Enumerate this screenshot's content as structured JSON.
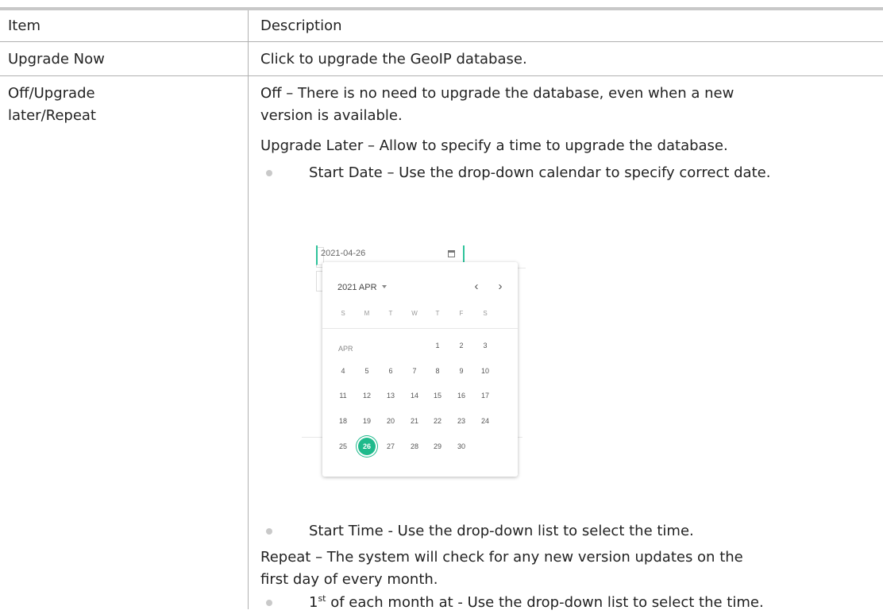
{
  "table": {
    "header": {
      "item": "Item",
      "description": "Description"
    },
    "row_upgrade_now": {
      "item": "Upgrade Now",
      "description": "Click to upgrade the GeoIP database."
    },
    "row_off": {
      "item": "Off/Upgrade later/Repeat",
      "off_line1": "Off – There is no need to upgrade the database, even when a new",
      "off_line2": "version is available.",
      "upgrade_later": "Upgrade Later – Allow to specify a time to upgrade the database.",
      "start_date": "Start Date – Use the drop-down calendar to specify correct date.",
      "start_time": "Start Time - Use the drop-down list to select the time.",
      "repeat_line1": "Repeat – The system will check for any new version updates on the",
      "repeat_line2": "first day of every month.",
      "first_prefix": "1",
      "first_sup": "st",
      "first_rest": " of each month at - Use the drop-down list to select the time."
    }
  },
  "calendar": {
    "input_value": "2021-04-26",
    "header": "2021 APR",
    "prev": "‹",
    "next": "›",
    "weekdays": [
      "S",
      "M",
      "T",
      "W",
      "T",
      "F",
      "S"
    ],
    "month_label": "APR",
    "weeks": [
      [
        "",
        "",
        "",
        "",
        "1",
        "2",
        "3"
      ],
      [
        "4",
        "5",
        "6",
        "7",
        "8",
        "9",
        "10"
      ],
      [
        "11",
        "12",
        "13",
        "14",
        "15",
        "16",
        "17"
      ],
      [
        "18",
        "19",
        "20",
        "21",
        "22",
        "23",
        "24"
      ],
      [
        "25",
        "26",
        "27",
        "28",
        "29",
        "30",
        ""
      ]
    ],
    "selected_day": "26",
    "accent_color": "#1fba8c",
    "input_border_color": "#2fc39b",
    "icon": "calendar-icon"
  }
}
